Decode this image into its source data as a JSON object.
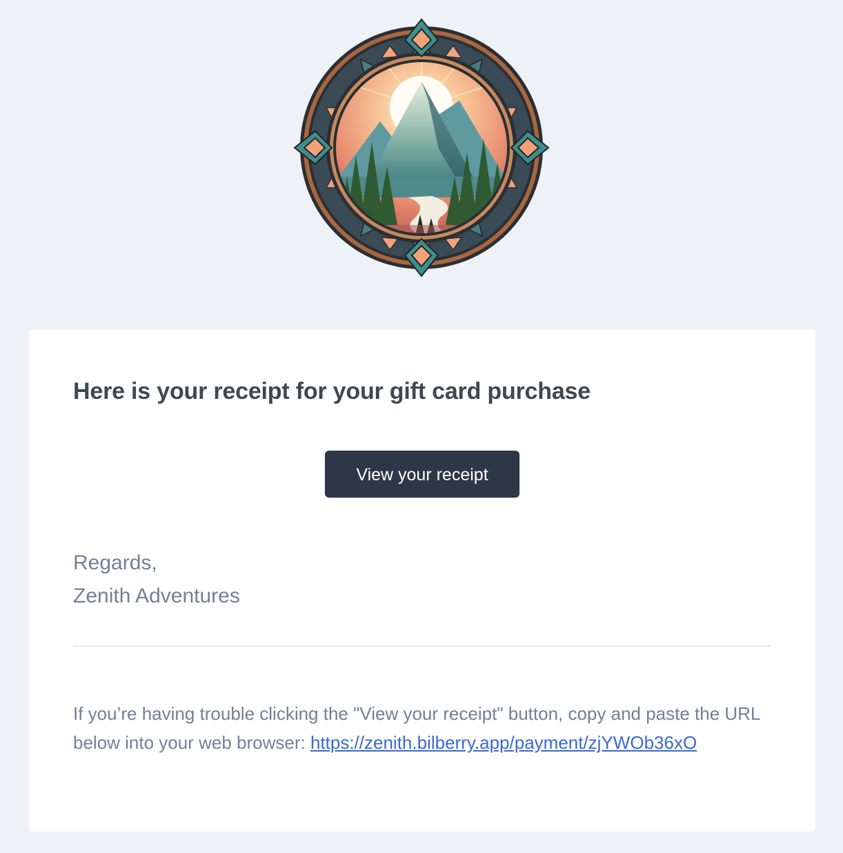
{
  "logo": {
    "icon": "mountain-emblem-logo",
    "colors": {
      "teal": "#3f8f8c",
      "peach": "#f2a27a",
      "dark": "#2d3748",
      "bronze": "#a8673f"
    }
  },
  "email": {
    "heading": "Here is your receipt for your gift card purchase",
    "button_label": "View your receipt",
    "regards_line1": "Regards,",
    "regards_line2": "Zenith Adventures",
    "trouble_text": "If you’re having trouble clicking the \"View your receipt\" button, copy and paste the URL below into your web browser: ",
    "url": "https://zenith.bilberry.app/payment/zjYWOb36xO"
  },
  "colors": {
    "page_background": "#eef1f6",
    "button_background": "#2d3748",
    "heading_text": "#3d4852",
    "body_text": "#718096",
    "link": "#3869d4"
  }
}
